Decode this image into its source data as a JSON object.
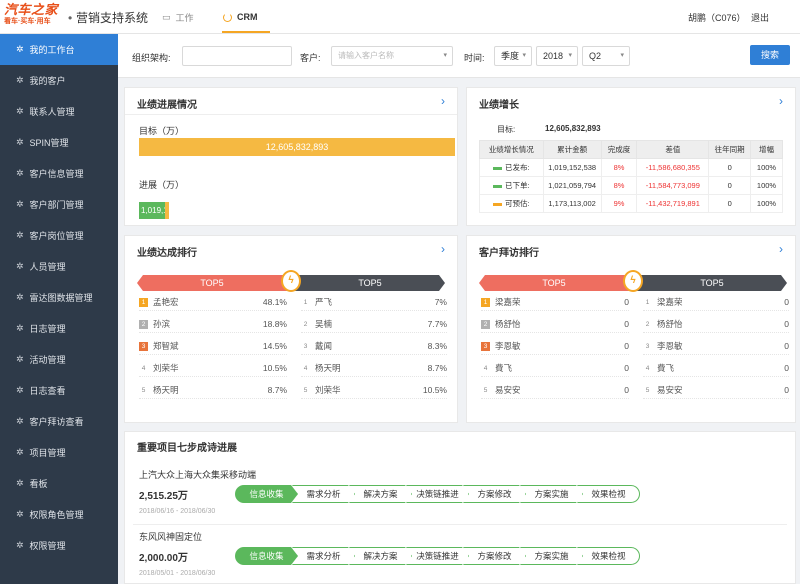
{
  "header": {
    "logo_main": "汽车之家",
    "logo_sub": "看车·买车·用车",
    "system_title": "营销支持系统",
    "nav_work": "工作",
    "nav_crm": "CRM",
    "user": "胡鹏（C076）",
    "logout": "退出"
  },
  "sidebar": {
    "items": [
      {
        "label": "我的工作台"
      },
      {
        "label": "我的客户"
      },
      {
        "label": "联系人管理"
      },
      {
        "label": "SPIN管理"
      },
      {
        "label": "客户信息管理"
      },
      {
        "label": "客户部门管理"
      },
      {
        "label": "客户岗位管理"
      },
      {
        "label": "人员管理"
      },
      {
        "label": "雷达图数据管理"
      },
      {
        "label": "日志管理"
      },
      {
        "label": "活动管理"
      },
      {
        "label": "日志查看"
      },
      {
        "label": "客户拜访查看"
      },
      {
        "label": "项目管理"
      },
      {
        "label": "看板"
      },
      {
        "label": "权限角色管理"
      },
      {
        "label": "权限管理"
      }
    ]
  },
  "filter": {
    "org_label": "组织架构:",
    "org_value": "",
    "customer_label": "客户:",
    "customer_placeholder": "请输入客户名称",
    "time_label": "时间:",
    "period": "季度",
    "year": "2018",
    "quarter": "Q2",
    "search_button": "搜索"
  },
  "progress": {
    "title": "业绩进展情况",
    "target_label": "目标（万）",
    "target_value": "12,605,832,893",
    "progress_label": "进展（万）",
    "progress_value": "1,019,152,538",
    "progress_fraction": 0.081,
    "progress_extra_fraction": 0.012
  },
  "growth": {
    "title": "业绩增长",
    "target_label": "目标:",
    "target_value": "12,605,832,893",
    "columns": [
      "业绩增长情况",
      "累计金额",
      "完成度",
      "差值",
      "往年同期",
      "增幅"
    ],
    "rows": [
      {
        "name": "已发布:",
        "color": "#5bb85c",
        "amount": "1,019,152,538",
        "rate": "8%",
        "diff": "-11,586,680,355",
        "last_year": "0",
        "growth": "100%"
      },
      {
        "name": "已下单:",
        "color": "#5bb85c",
        "amount": "1,021,059,794",
        "rate": "8%",
        "diff": "-11,584,773,099",
        "last_year": "0",
        "growth": "100%"
      },
      {
        "name": "可预估:",
        "color": "#f5a623",
        "amount": "1,173,113,002",
        "rate": "9%",
        "diff": "-11,432,719,891",
        "last_year": "0",
        "growth": "100%"
      }
    ]
  },
  "ranking": {
    "title": "业绩达成排行",
    "left_header": "TOP5",
    "right_header": "TOP5",
    "left": [
      {
        "rank": "1",
        "name": "孟艳宏",
        "value": "48.1%"
      },
      {
        "rank": "2",
        "name": "孙滨",
        "value": "18.8%"
      },
      {
        "rank": "3",
        "name": "郑智斌",
        "value": "14.5%"
      },
      {
        "rank": "4",
        "name": "刘荣华",
        "value": "10.5%"
      },
      {
        "rank": "5",
        "name": "杨天明",
        "value": "8.7%"
      }
    ],
    "right": [
      {
        "rank": "1",
        "name": "严飞",
        "value": "7%"
      },
      {
        "rank": "2",
        "name": "吴楠",
        "value": "7.7%"
      },
      {
        "rank": "3",
        "name": "戴闻",
        "value": "8.3%"
      },
      {
        "rank": "4",
        "name": "杨天明",
        "value": "8.7%"
      },
      {
        "rank": "5",
        "name": "刘荣华",
        "value": "10.5%"
      }
    ]
  },
  "visits": {
    "title": "客户拜访排行",
    "left_header": "TOP5",
    "right_header": "TOP5",
    "left": [
      {
        "rank": "1",
        "name": "梁嘉荣",
        "value": "0"
      },
      {
        "rank": "2",
        "name": "杨舒怡",
        "value": "0"
      },
      {
        "rank": "3",
        "name": "李恩敏",
        "value": "0"
      },
      {
        "rank": "4",
        "name": "費飞",
        "value": "0"
      },
      {
        "rank": "5",
        "name": "易安安",
        "value": "0"
      }
    ],
    "right": [
      {
        "rank": "1",
        "name": "梁嘉荣",
        "value": "0"
      },
      {
        "rank": "2",
        "name": "杨舒怡",
        "value": "0"
      },
      {
        "rank": "3",
        "name": "李恩敏",
        "value": "0"
      },
      {
        "rank": "4",
        "name": "費飞",
        "value": "0"
      },
      {
        "rank": "5",
        "name": "易安安",
        "value": "0"
      }
    ]
  },
  "projects": {
    "title": "重要项目七步成诗进展",
    "steps": [
      "信息收集",
      "需求分析",
      "解决方案",
      "决策链推进",
      "方案修改",
      "方案实施",
      "效果检视"
    ],
    "items": [
      {
        "name": "上汽大众上海大众集采移动端",
        "amount": "2,515.25万",
        "date": "2018/06/16 - 2018/06/30",
        "current_step": 1
      },
      {
        "name": "东风风神固定位",
        "amount": "2,000.00万",
        "date": "2018/05/01 - 2018/06/30",
        "current_step": 1
      }
    ]
  },
  "colors": {
    "accent": "#2f7fd6",
    "sidebar_bg": "#2e3a49",
    "orange": "#f5b942",
    "green": "#5bb85c",
    "red": "#ee6e60",
    "dark": "#4a4e55"
  }
}
